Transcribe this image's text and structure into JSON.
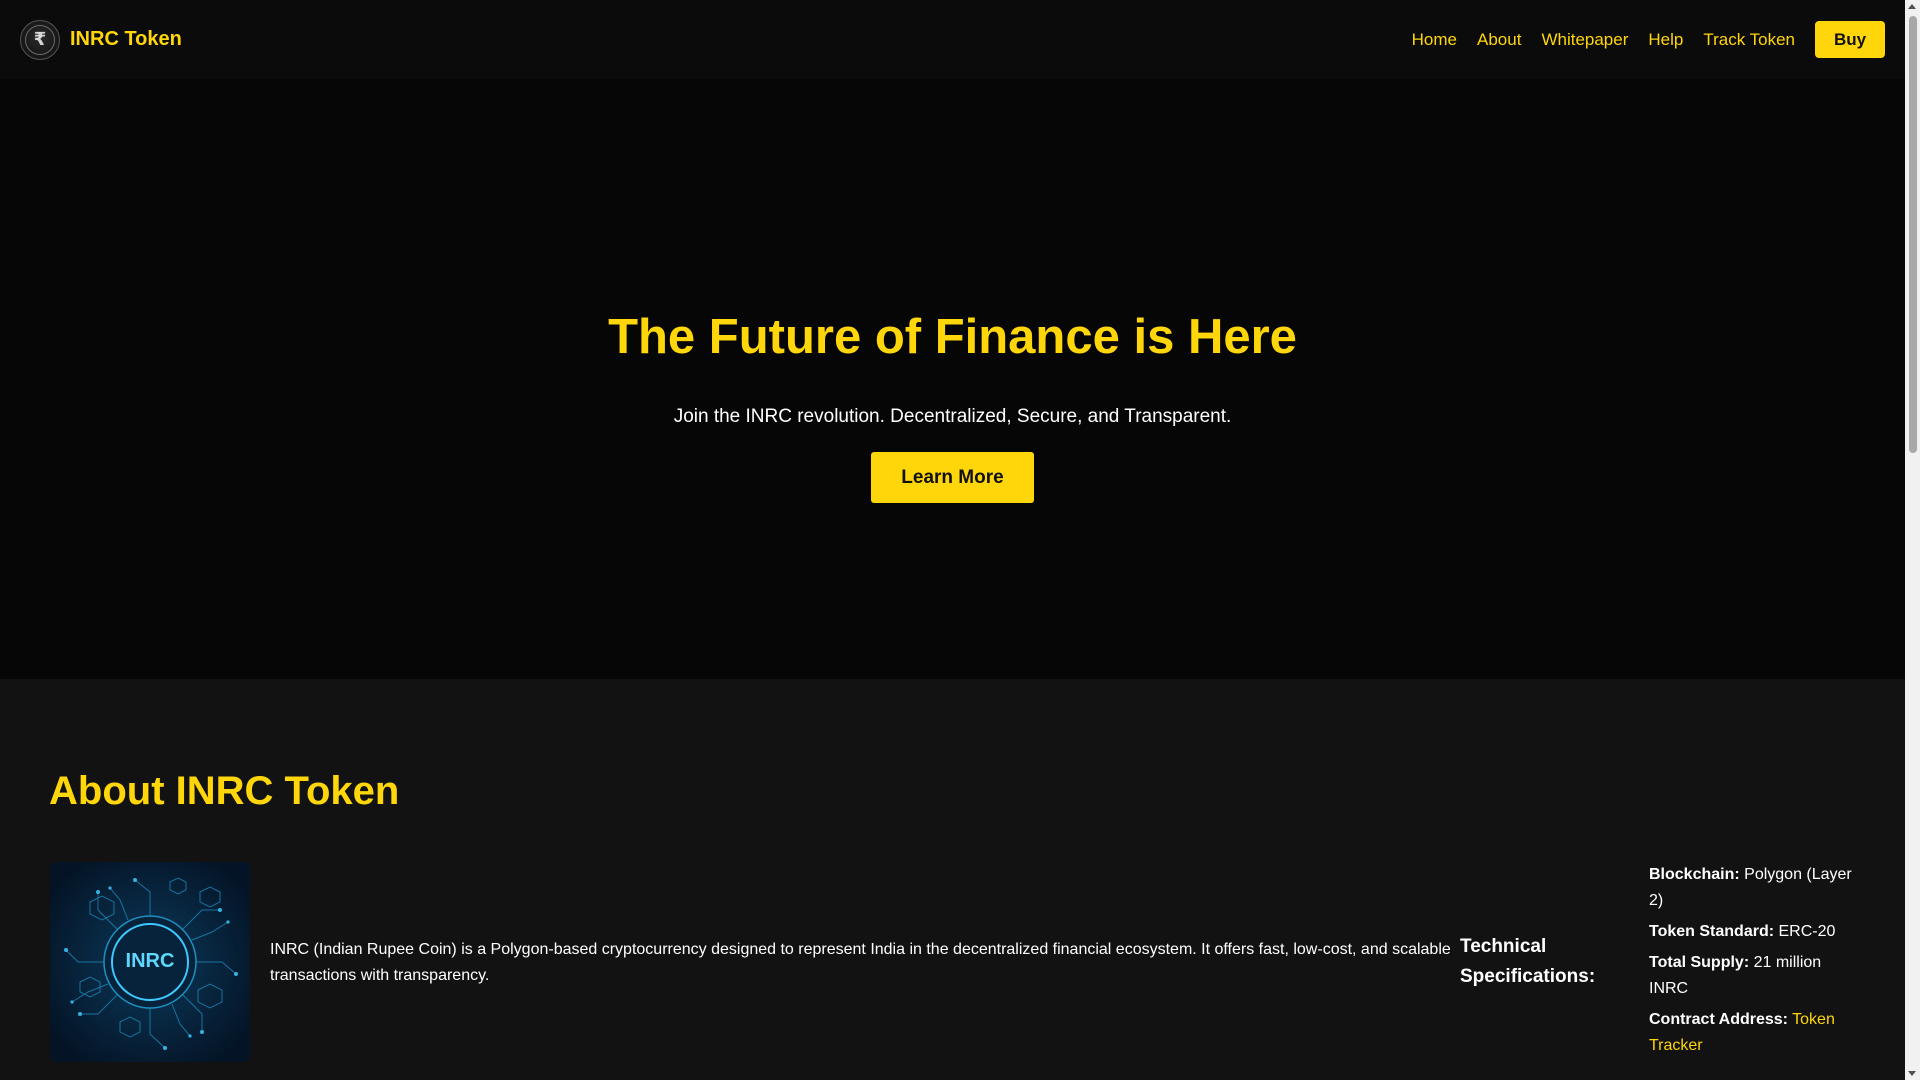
{
  "header": {
    "logo_glyph": "₹",
    "brand_name": "INRC Token",
    "nav": [
      "Home",
      "About",
      "Whitepaper",
      "Help",
      "Track Token"
    ],
    "buy_label": "Buy"
  },
  "hero": {
    "title": "The Future of Finance is Here",
    "subtitle": "Join the INRC revolution. Decentralized, Secure, and Transparent.",
    "cta_label": "Learn More"
  },
  "about": {
    "title": "About INRC Token",
    "image_label": "INRC",
    "description": "INRC (Indian Rupee Coin) is a Polygon-based cryptocurrency designed to represent India in the decentralized financial ecosystem. It offers fast, low-cost, and scalable transactions with transparency.",
    "specs_title": "Technical Specifications:",
    "specs": [
      {
        "label": "Blockchain:",
        "value": "Polygon (Layer 2)"
      },
      {
        "label": "Token Standard:",
        "value": "ERC-20"
      },
      {
        "label": "Total Supply:",
        "value": "21 million INRC"
      },
      {
        "label": "Contract Address:",
        "link": "Token Tracker"
      }
    ]
  },
  "colors": {
    "accent": "#ffd60a",
    "background": "#060606",
    "section_bg": "#121212"
  }
}
